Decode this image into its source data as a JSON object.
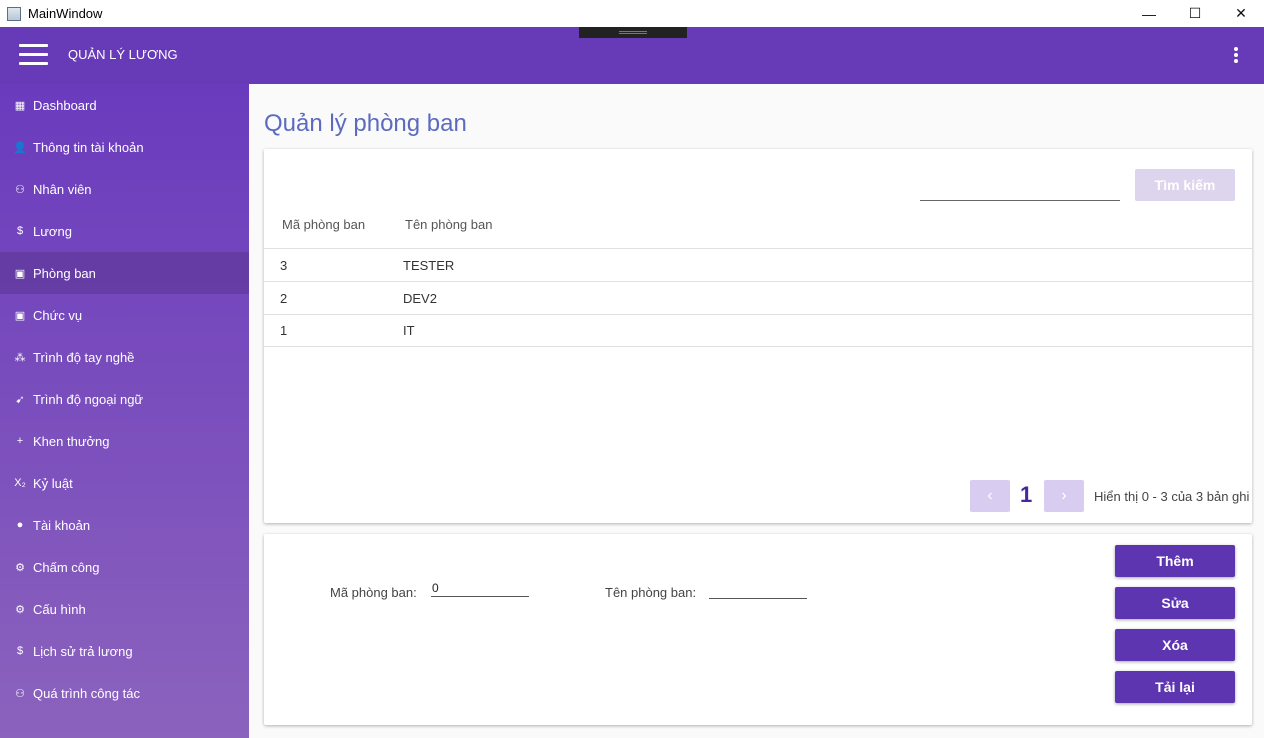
{
  "window": {
    "title": "MainWindow",
    "minimize": "—",
    "maximize": "☐",
    "close": "✕"
  },
  "appbar": {
    "title": "QUẢN LÝ LƯƠNG"
  },
  "sidebar": {
    "items": [
      {
        "label": "Dashboard",
        "icon": "dashboard-icon",
        "glyph": "▦"
      },
      {
        "label": "Thông tin tài khoản",
        "icon": "account-check-icon",
        "glyph": "👤"
      },
      {
        "label": "Nhân viên",
        "icon": "people-icon",
        "glyph": "⚇"
      },
      {
        "label": "Lương",
        "icon": "dollar-circle-icon",
        "glyph": "$"
      },
      {
        "label": "Phòng ban",
        "icon": "building-icon",
        "glyph": "▣"
      },
      {
        "label": "Chức vụ",
        "icon": "building-icon",
        "glyph": "▣"
      },
      {
        "label": "Trình độ tay nghề",
        "icon": "hierarchy-icon",
        "glyph": "⁂"
      },
      {
        "label": "Trình độ ngoại ngữ",
        "icon": "swift-icon",
        "glyph": "➹"
      },
      {
        "label": "Khen thưởng",
        "icon": "plus-icon",
        "glyph": "+"
      },
      {
        "label": "Kỷ luật",
        "icon": "subscript-x-icon",
        "glyph": "X₂"
      },
      {
        "label": "Tài khoản",
        "icon": "person-icon",
        "glyph": "●"
      },
      {
        "label": "Chấm công",
        "icon": "gear-icon",
        "glyph": "⚙"
      },
      {
        "label": "Cấu hình",
        "icon": "gear-icon",
        "glyph": "⚙"
      },
      {
        "label": "Lịch sử trả lương",
        "icon": "dollar-circle-icon",
        "glyph": "$"
      },
      {
        "label": "Quá trình công tác",
        "icon": "people-icon",
        "glyph": "⚇"
      }
    ],
    "active_index": 4
  },
  "main": {
    "page_title": "Quản lý phòng ban",
    "search": {
      "value": "",
      "button_label": "Tìm kiếm"
    },
    "table": {
      "headers": [
        "Mã phòng ban",
        "Tên phòng ban"
      ],
      "rows": [
        [
          "3",
          "TESTER"
        ],
        [
          "2",
          "DEV2"
        ],
        [
          "1",
          "IT"
        ]
      ]
    },
    "pager": {
      "prev": "‹",
      "next": "›",
      "page": "1",
      "info": "Hiển thị 0 - 3 của 3 bản ghi"
    },
    "form": {
      "ma_label": "Mã phòng ban:",
      "ma_value": "0",
      "ten_label": "Tên phòng ban:",
      "ten_value": ""
    },
    "actions": {
      "add": "Thêm",
      "edit": "Sửa",
      "delete": "Xóa",
      "reload": "Tải lại"
    }
  },
  "colors": {
    "primary": "#673ab7",
    "button": "#5e35b1",
    "title": "#5c6bc0"
  }
}
